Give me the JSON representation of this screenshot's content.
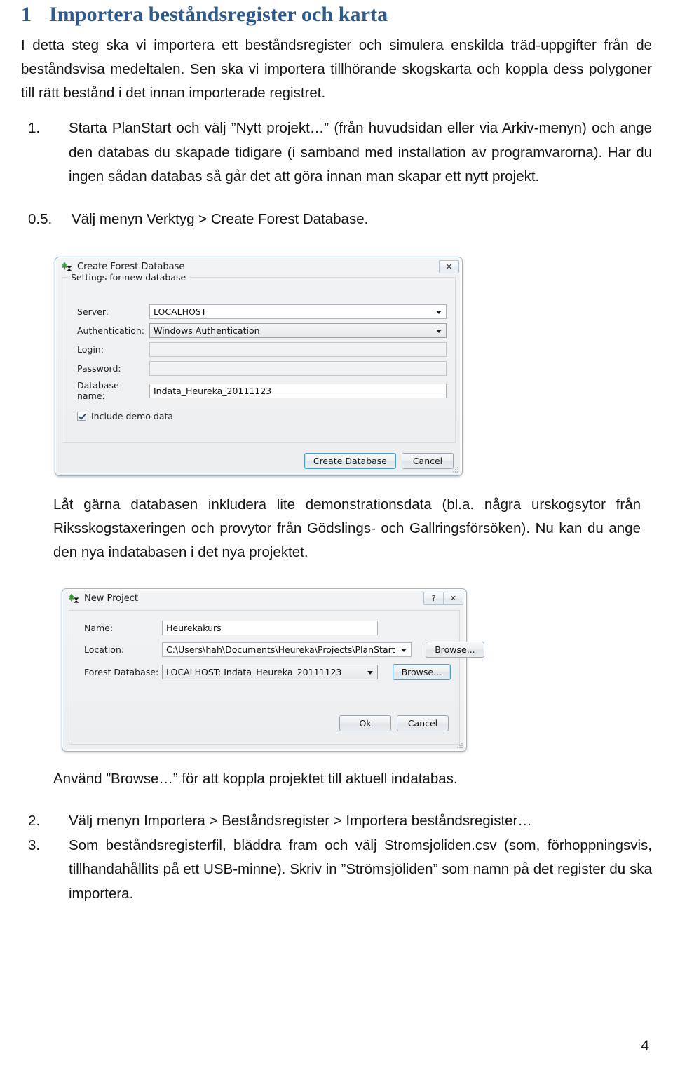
{
  "heading": {
    "number": "1",
    "text": "Importera beståndsregister och karta",
    "color": "#2e5a8c"
  },
  "intro_paragraph": "I detta steg ska vi importera ett beståndsregister och simulera enskilda träd-uppgifter från de beståndsvisa medeltalen. Sen ska vi importera tillhörande skogskarta och koppla dess polygoner till rätt bestånd i det innan importerade registret.",
  "steps": {
    "step1": {
      "marker": "1.",
      "text": "Starta PlanStart och välj ”Nytt projekt…” (från huvudsidan eller via Arkiv-menyn) och ange den databas du skapade tidigare (i samband med installation av programvarorna). Har du ingen sådan databas så går det att göra innan man skapar ett nytt projekt."
    },
    "step05": {
      "marker": "0.5.",
      "text": "Välj menyn Verktyg > Create Forest Database."
    },
    "step2": {
      "marker": "2.",
      "text": "Välj menyn Importera > Beståndsregister > Importera beståndsregister…"
    },
    "step3": {
      "marker": "3.",
      "text": "Som beståndsregisterfil, bläddra fram och välj Stromsjoliden.csv (som, förhoppningsvis, tillhandahållits på ett USB-minne). Skriv in ”Strömsjöliden” som namn på det register du ska importera."
    }
  },
  "paragraph_after_db_dialog": "Låt gärna databasen inkludera lite demonstrationsdata (bl.a. några urskogsytor från Riksskogstaxeringen och provytor från Gödslings- och Gallringsförsöken). Nu kan du ange den nya indatabasen i det nya projektet.",
  "paragraph_after_project_dialog": "Använd ”Browse…” för att koppla projektet till aktuell indatabas.",
  "dialog_create_db": {
    "title": "Create Forest Database",
    "icon": "tree-icon",
    "close_label": "✕",
    "groupbox_legend": "Settings for new database",
    "fields": [
      {
        "label": "Server:",
        "value": "LOCALHOST",
        "type": "combo"
      },
      {
        "label": "Authentication:",
        "value": "Windows Authentication",
        "type": "combo-shaded"
      },
      {
        "label": "Login:",
        "value": "",
        "type": "textbox-disabled"
      },
      {
        "label": "Password:",
        "value": "",
        "type": "textbox-disabled"
      },
      {
        "label": "Database name:",
        "value": "Indata_Heureka_20111123",
        "type": "textbox"
      }
    ],
    "checkbox": {
      "label": "Include demo data",
      "checked": true
    },
    "buttons": {
      "primary": "Create Database",
      "secondary": "Cancel"
    }
  },
  "dialog_new_project": {
    "title": "New Project",
    "icon": "tree-icon",
    "help_label": "?",
    "close_label": "✕",
    "fields": [
      {
        "label": "Name:",
        "value": "Heurekakurs",
        "type": "textbox",
        "browse": null
      },
      {
        "label": "Location:",
        "value": "C:\\Users\\hah\\Documents\\Heureka\\Projects\\PlanStart",
        "type": "combo",
        "browse": "Browse..."
      },
      {
        "label": "Forest Database:",
        "value": "LOCALHOST: Indata_Heureka_20111123",
        "type": "combo-shaded",
        "browse": "Browse..."
      }
    ],
    "buttons": {
      "primary": "Ok",
      "secondary": "Cancel"
    }
  },
  "page_number": "4"
}
